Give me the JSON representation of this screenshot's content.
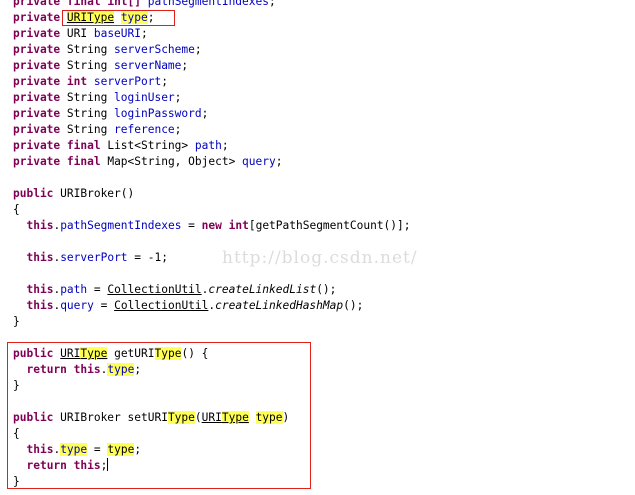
{
  "editor": {
    "lines": [
      [
        "private",
        " ",
        "final",
        " int[] ",
        "pathSegmentIndexes",
        ";"
      ],
      [
        "private",
        " ",
        "URIType",
        " ",
        "type",
        ";"
      ],
      [
        "private",
        " URI ",
        "baseURI",
        ";"
      ],
      [
        "private",
        " String ",
        "serverScheme",
        ";"
      ],
      [
        "private",
        " String ",
        "serverName",
        ";"
      ],
      [
        "private",
        " ",
        "int",
        " ",
        "serverPort",
        ";"
      ],
      [
        "private",
        " String ",
        "loginUser",
        ";"
      ],
      [
        "private",
        " String ",
        "loginPassword",
        ";"
      ],
      [
        "private",
        " String ",
        "reference",
        ";"
      ],
      [
        "private",
        " ",
        "final",
        " List<String> ",
        "path",
        ";"
      ],
      [
        "private",
        " ",
        "final",
        " Map<String, Object> ",
        "query",
        ";"
      ],
      [],
      [
        "public",
        " URIBroker()"
      ],
      [
        "{"
      ],
      [
        "  ",
        "this",
        ".",
        "pathSegmentIndexes",
        " = ",
        "new",
        " ",
        "int",
        "[getPathSegmentCount()];"
      ],
      [],
      [
        "  ",
        "this",
        ".",
        "serverPort",
        " = -1;"
      ],
      [],
      [
        "  ",
        "this",
        ".",
        "path",
        " = ",
        "CollectionUtil",
        ".",
        "createLinkedList",
        "();"
      ],
      [
        "  ",
        "this",
        ".",
        "query",
        " = ",
        "CollectionUtil",
        ".",
        "createLinkedHashMap",
        "();"
      ],
      [
        "}"
      ],
      [],
      [
        "public",
        " ",
        "URI",
        "Type",
        " getURI",
        "Type",
        "() {"
      ],
      [
        "  ",
        "return",
        " ",
        "this",
        ".",
        "type",
        ";"
      ],
      [
        "}"
      ],
      [],
      [
        "public",
        " URIBroker setURI",
        "Type",
        "(",
        "URI",
        "Type",
        " ",
        "type",
        ")"
      ],
      [
        "{"
      ],
      [
        "  ",
        "this",
        ".",
        "type",
        " = ",
        "type",
        ";"
      ],
      [
        "  ",
        "return",
        " ",
        "this",
        ";"
      ],
      [
        "}"
      ]
    ]
  },
  "watermark": "http://blog.csdn.net/"
}
